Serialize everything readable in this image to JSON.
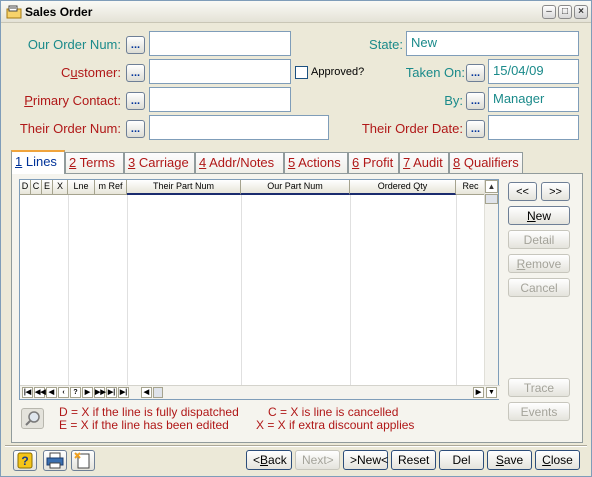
{
  "window": {
    "title": "Sales Order"
  },
  "header": {
    "our_order_num_label": "Our Order Num:",
    "customer_label_pre": "C",
    "customer_label_u": "u",
    "customer_label_post": "stomer:",
    "primary_contact_label_u": "P",
    "primary_contact_label_post": "rimary Contact:",
    "their_order_num_label": "Their Order Num:",
    "approved_label": "Approved?",
    "state_label": "State:",
    "state_value": "New",
    "taken_on_label": "Taken On:",
    "taken_on_value": "15/04/09",
    "by_label": "By:",
    "by_value": "Manager",
    "their_order_date_label": "Their Order Date:",
    "dots_label": "..."
  },
  "tabs": [
    {
      "num": "1",
      "label": " Lines"
    },
    {
      "num": "2",
      "label": " Terms"
    },
    {
      "num": "3",
      "label": " Carriage"
    },
    {
      "num": "4",
      "label": " Addr/Notes"
    },
    {
      "num": "5",
      "label": " Actions"
    },
    {
      "num": "6",
      "label": " Profit"
    },
    {
      "num": "7",
      "label": " Audit"
    },
    {
      "num": "8",
      "label": " Qualifiers"
    }
  ],
  "grid": {
    "columns": [
      "D",
      "C",
      "E",
      "X",
      "Lne",
      "m Ref",
      "Their Part Num",
      "Our Part Num",
      "Ordered Qty",
      "Rec"
    ]
  },
  "side_buttons": {
    "prev": "<<",
    "next": ">>",
    "new_u": "N",
    "new_post": "ew",
    "detail": "Detail",
    "remove_u": "R",
    "remove_post": "emove",
    "cancel": "Cancel",
    "trace": "Trace",
    "events": "Events"
  },
  "legend": {
    "line1_left": "D = X if the line is fully dispatched",
    "line1_right": "C = X is line is cancelled",
    "line2_left": "E = X if the line has been edited",
    "line2_right": "X = X if extra discount applies"
  },
  "bottom": {
    "back_pre": "<",
    "back_u": "B",
    "back_post": "ack",
    "next": "Next>",
    "new": ">New<",
    "reset": "Reset",
    "del": "Del",
    "save_u": "S",
    "save_post": "ave",
    "close_u": "C",
    "close_post": "lose"
  }
}
